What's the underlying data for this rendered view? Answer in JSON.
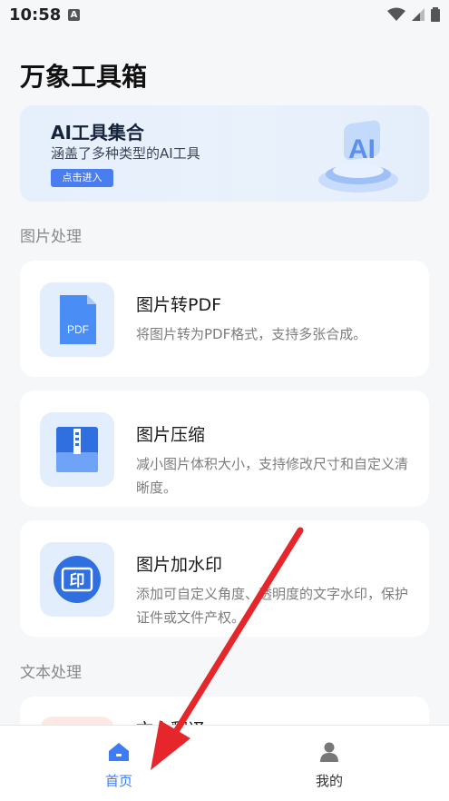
{
  "status_bar": {
    "time": "10:58",
    "notification_letter": "A"
  },
  "app": {
    "title": "万象工具箱"
  },
  "banner": {
    "title": "AI工具集合",
    "subtitle": "涵盖了多种类型的AI工具",
    "button_label": "点击进入",
    "art_text": "AI"
  },
  "sections": [
    {
      "label": "图片处理"
    },
    {
      "label": "文本处理"
    }
  ],
  "tools": [
    {
      "title": "图片转PDF",
      "desc": "将图片转为PDF格式，支持多张合成。",
      "icon": "pdf-file-icon",
      "icon_text": "PDF"
    },
    {
      "title": "图片压缩",
      "desc": "减小图片体积大小，支持修改尺寸和自定义清晰度。",
      "icon": "zip-compress-icon"
    },
    {
      "title": "图片加水印",
      "desc": "添加可自定义角度、透明度的文字水印，保护证件或文件产权。",
      "icon": "stamp-icon",
      "icon_text": "印"
    },
    {
      "title": "文本翻译",
      "icon": "text-icon"
    }
  ],
  "tabbar": {
    "home_label": "首页",
    "mine_label": "我的"
  },
  "colors": {
    "accent": "#3d7cf4",
    "icon_bg": "#e3eefc",
    "annotation_arrow": "#e5262b"
  }
}
